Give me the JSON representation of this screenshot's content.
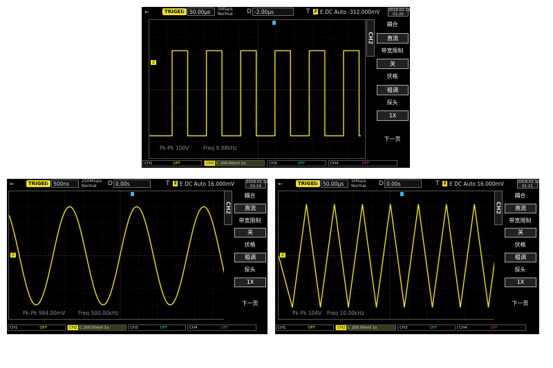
{
  "scopes": [
    {
      "id": "square",
      "status": "TRIGED",
      "timebase_label": "M",
      "timebase": "50.00µs",
      "sample_rate": "5MSa/s",
      "acq_mode": "Normal",
      "delay_label": "D",
      "delay": "-2.00µs",
      "trig_label": "T",
      "trig_channel": "2",
      "trig_info": "E  DC  Auto  -312.000mV",
      "date": "2018.02.10",
      "time": "01:20",
      "measure_pk": "Pk-Pk  100V",
      "measure_freq": "Freq  9.98kHz",
      "waveform": "square",
      "menu": {
        "channel": "CH2",
        "coupling_title": "耦合",
        "coupling_value": "直流",
        "bw_title": "带宽限制",
        "bw_value": "关",
        "volts_title": "伏格",
        "volts_value": "粗调",
        "probe_title": "探头",
        "probe_value": "1X",
        "next": "下一页"
      },
      "channels": [
        {
          "name": "CH1",
          "value": "OFF"
        },
        {
          "name": "CH2",
          "value": "C  200.00mV  1x"
        },
        {
          "name": "CH3",
          "value": "OFF"
        },
        {
          "name": "CH4",
          "value": "OFF"
        }
      ]
    },
    {
      "id": "sine",
      "status": "TRIGED",
      "timebase_label": "M",
      "timebase": "500ns",
      "sample_rate": "250MSa/s",
      "acq_mode": "Normal",
      "delay_label": "D",
      "delay": "0.00s",
      "trig_label": "T",
      "trig_channel": "2",
      "trig_info": "E  DC  Auto  16.000mV",
      "date": "2018.02.10",
      "time": "01:19",
      "measure_pk": "Pk-Pk  984.00mV",
      "measure_freq": "Freq  500.00kHz",
      "waveform": "sine",
      "menu": {
        "channel": "CH2",
        "coupling_title": "耦合",
        "coupling_value": "直流",
        "bw_title": "带宽限制",
        "bw_value": "关",
        "volts_title": "伏格",
        "volts_value": "粗调",
        "probe_title": "探头",
        "probe_value": "1X",
        "next": "下一页"
      },
      "channels": [
        {
          "name": "CH1",
          "value": "OFF"
        },
        {
          "name": "CH2",
          "value": "C  200.00mV  1x"
        },
        {
          "name": "CH3",
          "value": "OFF"
        },
        {
          "name": "CH4",
          "value": "OFF"
        }
      ]
    },
    {
      "id": "triangle",
      "status": "TRIGED",
      "timebase_label": "M",
      "timebase": "50.00µs",
      "sample_rate": "5MSa/s",
      "acq_mode": "Normal",
      "delay_label": "D",
      "delay": "0.00s",
      "trig_label": "T",
      "trig_channel": "2",
      "trig_info": "E  DC  Auto  16.000mV",
      "date": "2018.02.10",
      "time": "01:21",
      "measure_pk": "Pk-Pk  104V",
      "measure_freq": "Freq  10.00kHz",
      "waveform": "triangle",
      "menu": {
        "channel": "CH2",
        "coupling_title": "耦合",
        "coupling_value": "直流",
        "bw_title": "带宽限制",
        "bw_value": "关",
        "volts_title": "伏格",
        "volts_value": "粗调",
        "probe_title": "探头",
        "probe_value": "1X",
        "next": "下一页"
      },
      "channels": [
        {
          "name": "CH1",
          "value": "OFF"
        },
        {
          "name": "CH2",
          "value": "C  200.00mV  1x"
        },
        {
          "name": "CH3",
          "value": "OFF"
        },
        {
          "name": "CH4",
          "value": "OFF"
        }
      ]
    }
  ],
  "colors": {
    "trace": "#f2e600",
    "grid": "#3a3a3a",
    "ch1": "#f2e600",
    "ch2": "#f2e600",
    "ch3": "#38d66b",
    "ch4": "#d23cc8"
  }
}
